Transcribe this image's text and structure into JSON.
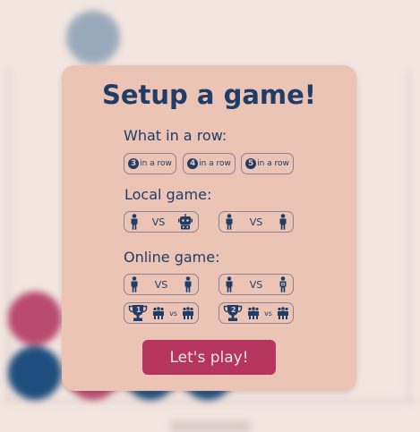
{
  "modal": {
    "title": "Setup a game!",
    "row_section_label": "What in a row:",
    "row_options": [
      {
        "number": "3",
        "label": "in a row"
      },
      {
        "number": "4",
        "label": "in a row"
      },
      {
        "number": "5",
        "label": "in a row"
      }
    ],
    "local_section_label": "Local game:",
    "local_options": [
      {
        "vs_label": "VS",
        "opponent_icon": "robot-icon"
      },
      {
        "vs_label": "VS",
        "opponent_icon": "person-icon"
      }
    ],
    "online_section_label": "Online game:",
    "online_options": [
      {
        "vs_label": "VS",
        "opponent_icon": "person-icon"
      },
      {
        "vs_label": "VS",
        "opponent_icon": "masked-person-icon"
      }
    ],
    "tournament_options": [
      {
        "badge": "1",
        "vs_label": "vs"
      },
      {
        "badge": "2",
        "vs_label": "vs"
      }
    ],
    "play_button_label": "Let's play!"
  },
  "colors": {
    "background": "#f3e6e1",
    "modal": "#ecc4b5",
    "ink": "#1f3d66",
    "accent": "#b5355f",
    "disc_blue": "#1f4e7e",
    "disc_red": "#b94a70"
  }
}
